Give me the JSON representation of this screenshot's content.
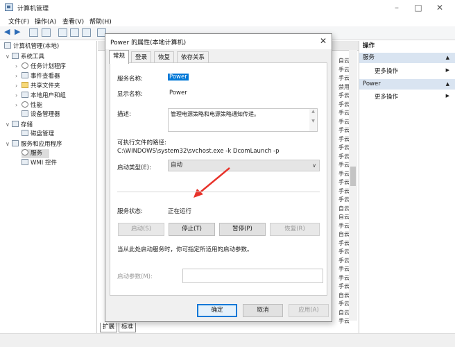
{
  "window": {
    "title": "计算机管理"
  },
  "menu": [
    "文件(F)",
    "操作(A)",
    "查看(V)",
    "帮助(H)"
  ],
  "tree": {
    "root": "计算机管理(本地)",
    "system_tools": "系统工具",
    "task_scheduler": "任务计划程序",
    "event_viewer": "事件查看器",
    "shared_folders": "共享文件夹",
    "local_users": "本地用户和组",
    "performance": "性能",
    "device_manager": "设备管理器",
    "storage": "存储",
    "disk_management": "磁盘管理",
    "services_apps": "服务和应用程序",
    "services": "服务",
    "wmi": "WMI 控件"
  },
  "center": {
    "startup_col": [
      "自云",
      "手云",
      "手云",
      "禁用",
      "手云",
      "手云",
      "手云",
      "手云",
      "手云",
      "手云",
      "手云",
      "手云",
      "手云",
      "手云",
      "手云",
      "手云",
      "手云",
      "自云",
      "自云",
      "手云",
      "自云",
      "手云",
      "手云",
      "手云",
      "手云",
      "手云",
      "手云",
      "自云",
      "手云",
      "自云",
      "手云"
    ]
  },
  "actions": {
    "header": "操作",
    "section1": "服务",
    "more1": "更多操作",
    "section2": "Power",
    "more2": "更多操作"
  },
  "bottom_tabs": [
    "扩展",
    "标准"
  ],
  "dialog": {
    "title": "Power 的属性(本地计算机)",
    "tabs": [
      "常规",
      "登录",
      "恢复",
      "依存关系"
    ],
    "service_name_label": "服务名称:",
    "service_name": "Power",
    "display_name_label": "显示名称:",
    "display_name": "Power",
    "description_label": "描述:",
    "description": "管理电源策略和电源策略通知传递。",
    "exe_path_label": "可执行文件的路径:",
    "exe_path": "C:\\WINDOWS\\system32\\svchost.exe -k DcomLaunch -p",
    "startup_type_label": "启动类型(E):",
    "startup_type": "自动",
    "status_label": "服务状态:",
    "status": "正在运行",
    "btn_start": "启动(S)",
    "btn_stop": "停止(T)",
    "btn_pause": "暂停(P)",
    "btn_resume": "恢复(R)",
    "hint": "当从此处启动服务时，你可指定所适用的启动参数。",
    "params_label": "启动参数(M):",
    "params_value": "",
    "btn_ok": "确定",
    "btn_cancel": "取消",
    "btn_apply": "应用(A)"
  },
  "colors": {
    "selection": "#0078d7",
    "arrow": "#e8322a",
    "action_section": "#d9e4f1"
  }
}
